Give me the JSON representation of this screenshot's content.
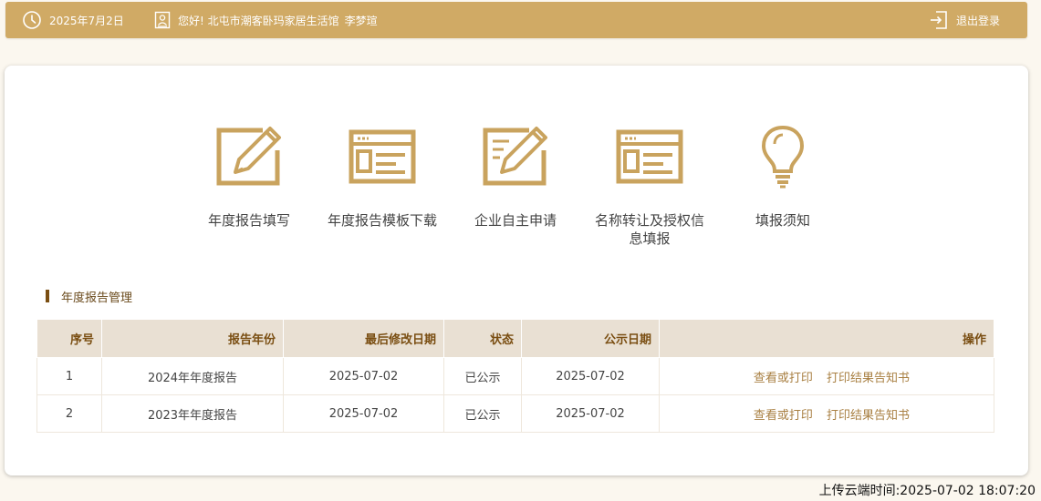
{
  "header": {
    "date": "2025年7月2日",
    "greeting": "您好! 北屯市潮客卧玛家居生活馆",
    "user_name": "李梦瑄",
    "logout_label": "退出登录"
  },
  "menu": [
    {
      "label": "年度报告填写",
      "icon": "edit-document-icon"
    },
    {
      "label": "年度报告模板下载",
      "icon": "template-window-icon"
    },
    {
      "label": "企业自主申请",
      "icon": "application-document-icon"
    },
    {
      "label": "名称转让及授权信息填报",
      "icon": "form-window-icon"
    },
    {
      "label": "填报须知",
      "icon": "lightbulb-icon"
    }
  ],
  "section": {
    "title": "年度报告管理"
  },
  "table": {
    "headers": [
      "序号",
      "报告年份",
      "最后修改日期",
      "状态",
      "公示日期",
      "操作"
    ],
    "rows": [
      {
        "index": "1",
        "year": "2024年年度报告",
        "modified": "2025-07-02",
        "status": "已公示",
        "published": "2025-07-02",
        "action_view": "查看或打印",
        "action_print": "打印结果告知书"
      },
      {
        "index": "2",
        "year": "2023年年度报告",
        "modified": "2025-07-02",
        "status": "已公示",
        "published": "2025-07-02",
        "action_view": "查看或打印",
        "action_print": "打印结果告知书"
      }
    ]
  },
  "footer": {
    "upload_time": "上传云端时间:2025-07-02 18:07:20"
  },
  "colors": {
    "header_bg": "#d0aa65",
    "icon_gold": "#c9a35e",
    "table_header_bg": "#e9e0d3",
    "table_header_text": "#7a4e12",
    "link": "#a98043"
  }
}
